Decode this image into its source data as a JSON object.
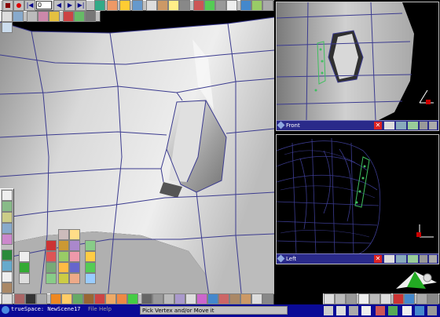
{
  "toolbar": {
    "frame_value": "0"
  },
  "viewports": {
    "front": {
      "label": "Front"
    },
    "left": {
      "label": "Left"
    }
  },
  "taskbar": {
    "app_title": "trueSpace: NewScene17",
    "menu_file": "File",
    "menu_help": "Help",
    "status": "Pick Vertex and/or Move it"
  },
  "colors": {
    "viewport_bar": "#2a2a8a",
    "wire": "#3b3b8f",
    "toolbar": "#c0c0c0",
    "taskbar": "#0a0a96"
  }
}
